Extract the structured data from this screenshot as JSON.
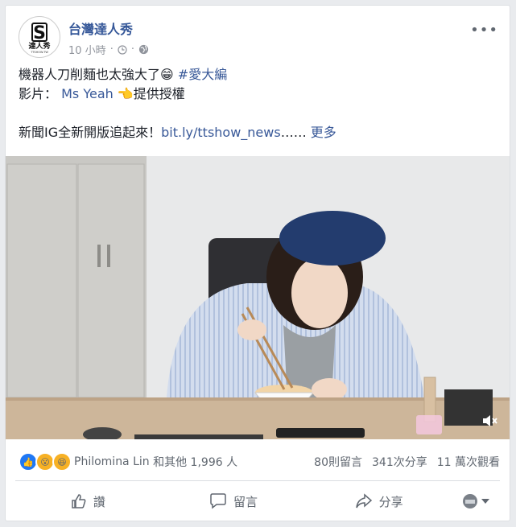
{
  "post": {
    "page_name": "台灣達人秀",
    "timestamp": "10 小時",
    "dot": "·",
    "text_line1_plain": "機器人刀削麵也太強大了😁 ",
    "text_line1_tag": "#愛大編",
    "text_line2_prefix": "影片：",
    "text_line2_link": "Ms Yeah",
    "text_line2_suffix": "👈提供授權",
    "text_line3_plain": "新聞IG全新開版追起來！",
    "text_line3_link": "bit.ly/ttshow_news",
    "ellipsis": "……",
    "see_more": "更多"
  },
  "avatar": {
    "logo_text": "達人秀",
    "logo_sub": "TTSHOW.TW"
  },
  "reactions": {
    "names": "Philomina Lin",
    "others": "和其他 1,996 人",
    "comments": "80則留言",
    "shares": "341次分享",
    "views": "11 萬次觀看"
  },
  "actions": {
    "like": "讚",
    "comment": "留言",
    "share": "分享"
  },
  "colors": {
    "link": "#385898",
    "page_name": "#365899",
    "like_blue": "#2078f4",
    "wow_yellow": "#f7b125"
  }
}
